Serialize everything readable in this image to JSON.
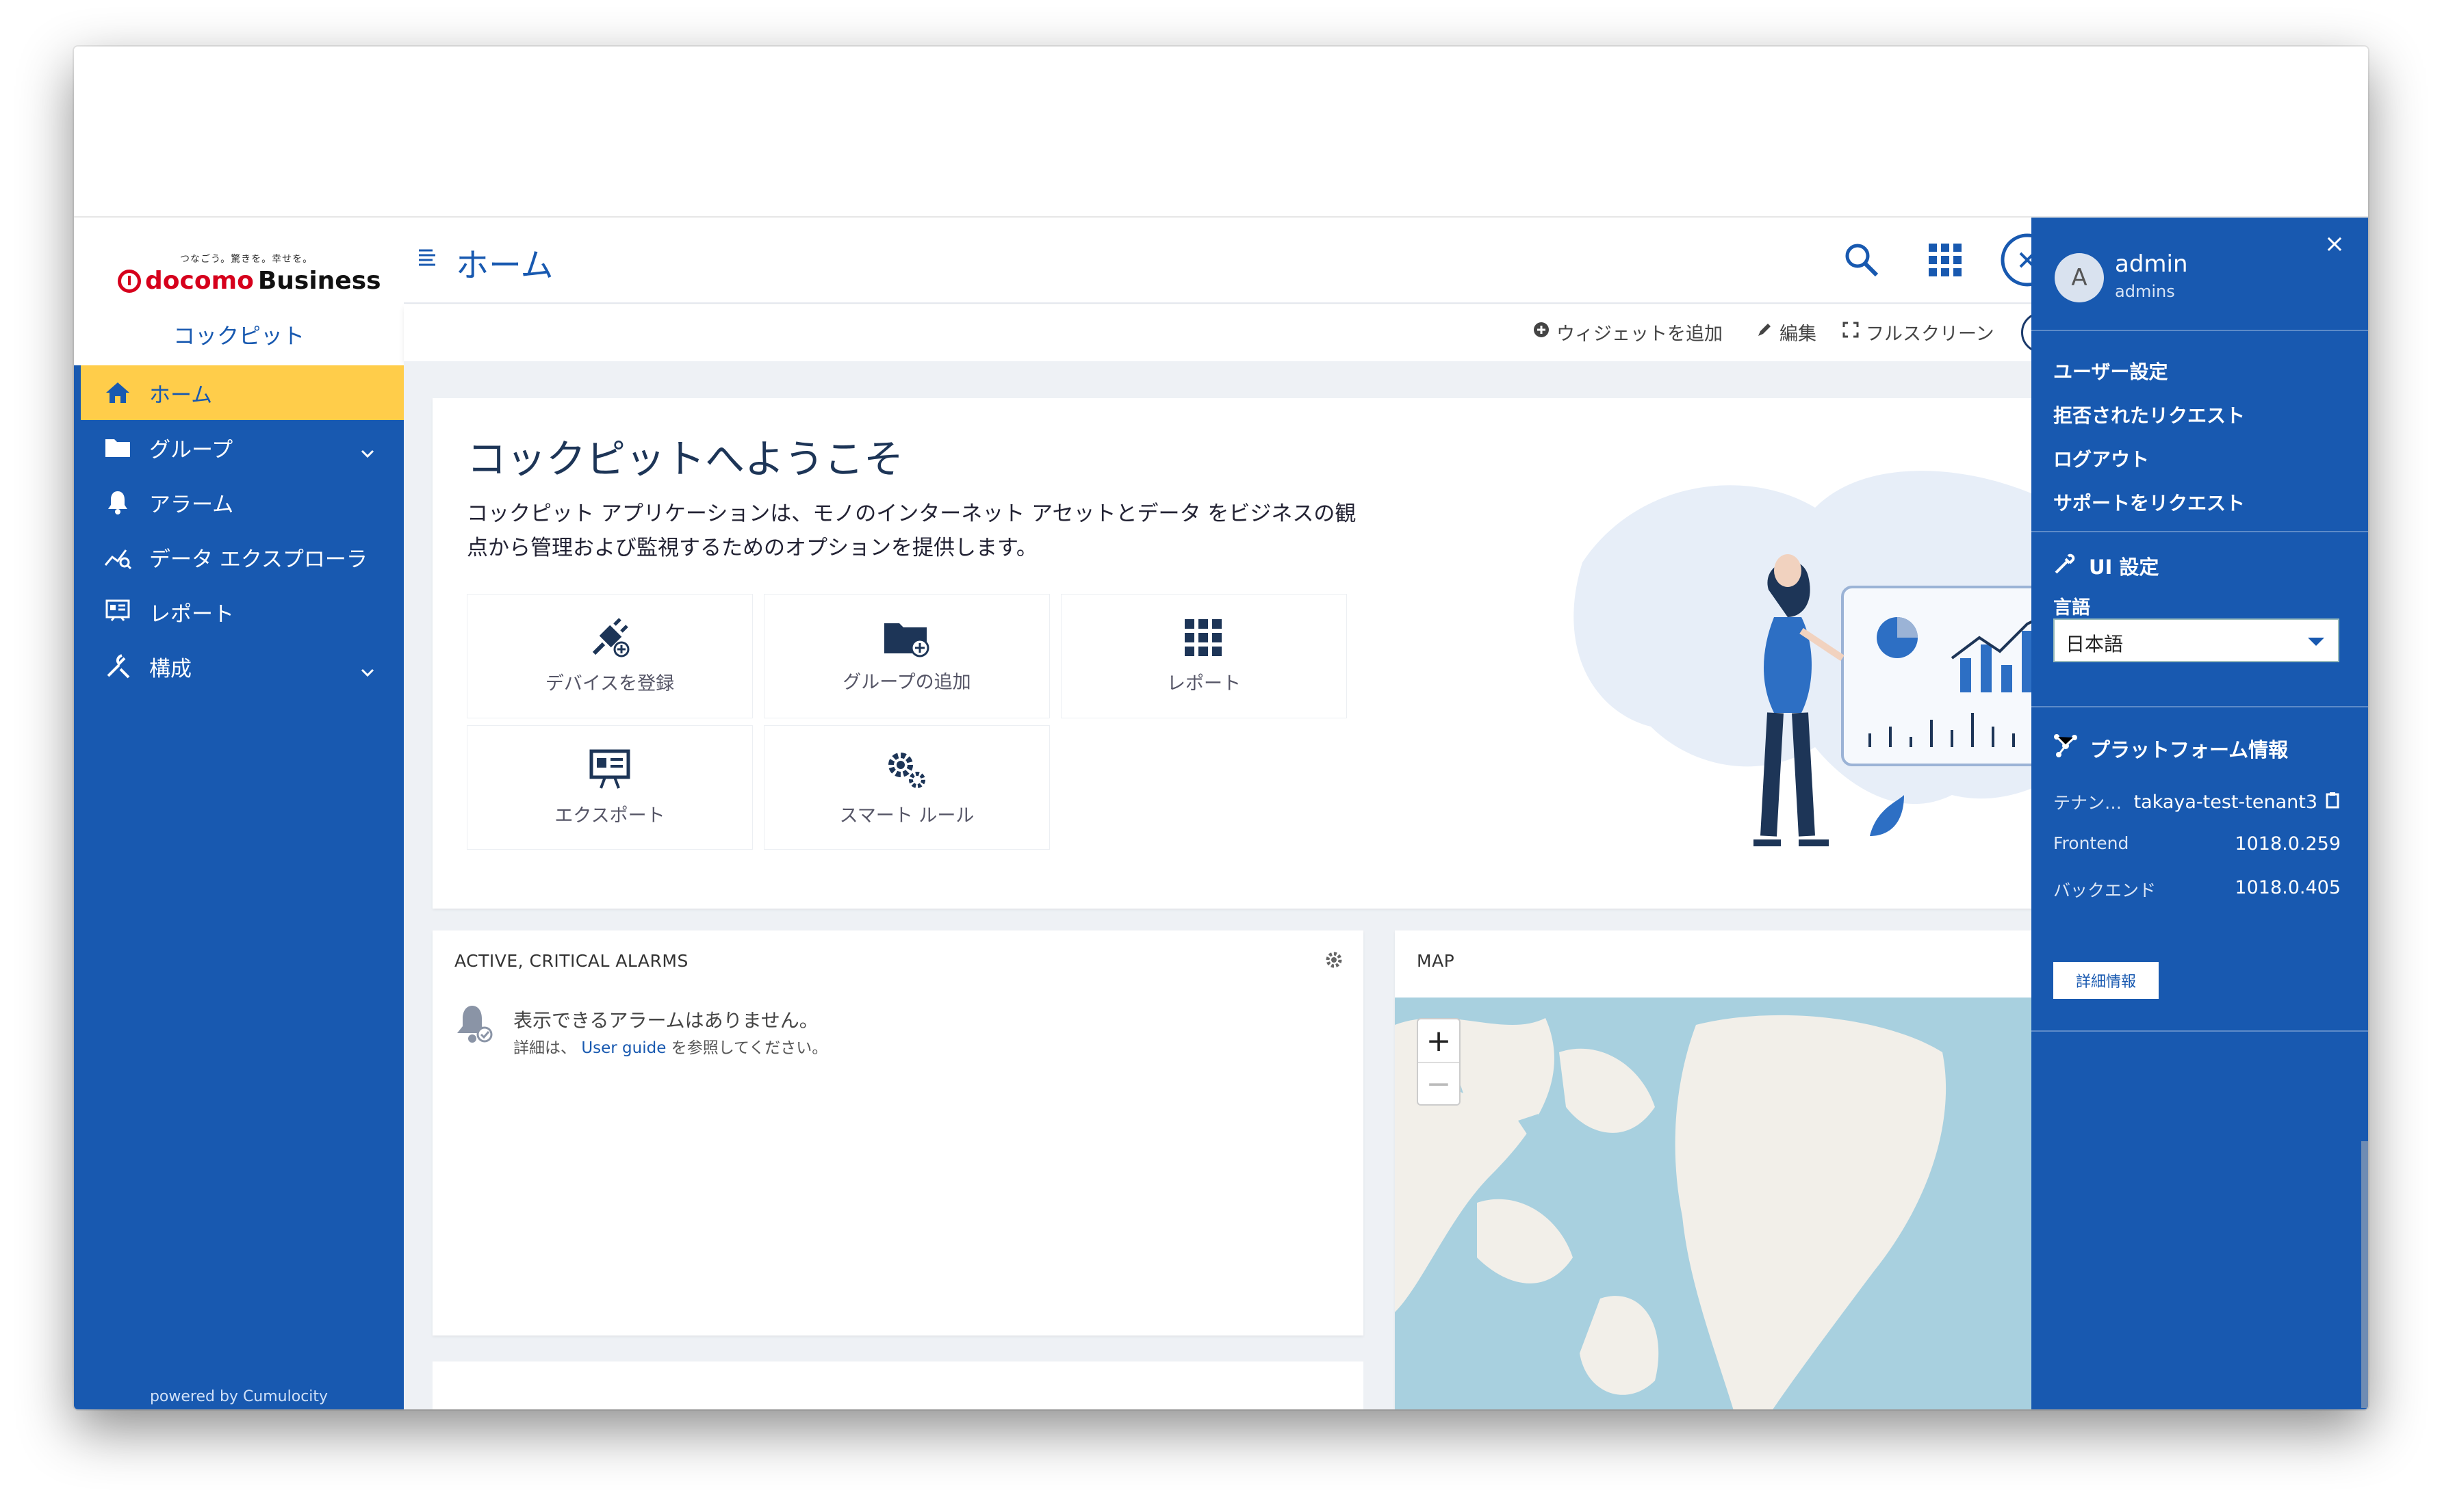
{
  "brand": {
    "tagline": "つなごう。驚きを。幸せを。",
    "name_red": "docomo",
    "name_black": "Business",
    "app": "コックピット",
    "powered": "powered by Cumulocity"
  },
  "nav": [
    {
      "label": "ホーム",
      "icon": "home-icon",
      "active": true
    },
    {
      "label": "グループ",
      "icon": "folder-icon",
      "expandable": true
    },
    {
      "label": "アラーム",
      "icon": "bell-icon"
    },
    {
      "label": "データ エクスプローラ",
      "icon": "data-explorer-icon"
    },
    {
      "label": "レポート",
      "icon": "report-icon"
    },
    {
      "label": "構成",
      "icon": "wrench-icon",
      "expandable": true
    }
  ],
  "header": {
    "title": "ホーム"
  },
  "actions": {
    "add_widget": "ウィジェットを追加",
    "edit": "編集",
    "fullscreen": "フルスクリーン"
  },
  "welcome": {
    "title": "コックピットへようこそ",
    "desc": "コックピット アプリケーションは、モノのインターネット アセットとデータ をビジネスの観点から管理および監視するためのオプションを提供します。",
    "tiles": [
      "デバイスを登録",
      "グループの追加",
      "レポート",
      "エクスポート",
      "スマート ルール"
    ]
  },
  "alarms": {
    "title": "ACTIVE, CRITICAL ALARMS",
    "empty": "表示できるアラームはありません。",
    "sub_pre": "詳細は、",
    "sub_link": "User guide",
    "sub_post": "を参照してください。"
  },
  "map": {
    "title": "MAP",
    "zoom_in": "+",
    "zoom_out": "−"
  },
  "panel": {
    "close": "×",
    "avatar": "A",
    "user": "admin",
    "role": "admins",
    "menu": [
      "ユーザー設定",
      "拒否されたリクエスト",
      "ログアウト",
      "サポートをリクエスト"
    ],
    "ui_title": "UI 設定",
    "lang_label": "言語",
    "lang_value": "日本語",
    "platform_title": "プラットフォーム情報",
    "tenant_label": "テナン…",
    "tenant_value": "takaya-test-tenant3",
    "frontend_label": "Frontend",
    "frontend_value": "1018.0.259",
    "backend_label": "バックエンド",
    "backend_value": "1018.0.405",
    "detail": "詳細情報"
  },
  "colors": {
    "primary": "#1859b0",
    "active": "#ffcd4a",
    "background": "#eef1f5"
  }
}
